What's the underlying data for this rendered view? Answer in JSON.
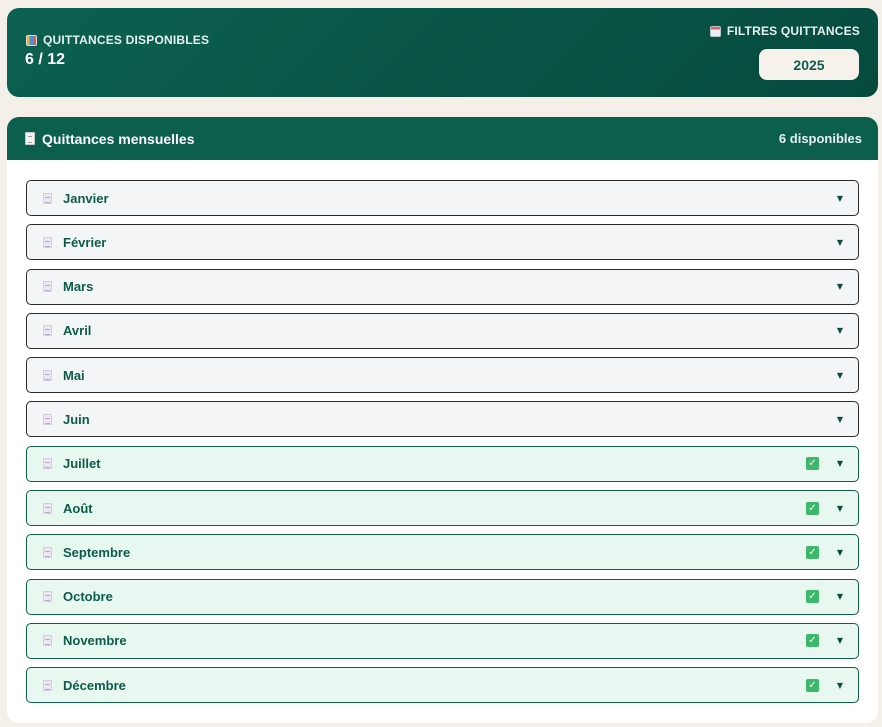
{
  "stats": {
    "label": "QUITTANCES DISPONIBLES",
    "value": "6 / 12",
    "icon": "bar-chart-icon"
  },
  "filters": {
    "label": "FILTRES QUITTANCES",
    "icon": "calendar-icon",
    "year": "2025"
  },
  "main": {
    "title": "Quittances mensuelles",
    "icon": "receipt-icon",
    "available_label": "6 disponibles"
  },
  "colors": {
    "primary": "#0c5e4d",
    "background": "#f5efe9",
    "available_bg": "#e8f7f0",
    "check": "#3cb86a"
  },
  "months": [
    {
      "name": "Janvier",
      "available": false
    },
    {
      "name": "Février",
      "available": false
    },
    {
      "name": "Mars",
      "available": false
    },
    {
      "name": "Avril",
      "available": false
    },
    {
      "name": "Mai",
      "available": false
    },
    {
      "name": "Juin",
      "available": false
    },
    {
      "name": "Juillet",
      "available": true
    },
    {
      "name": "Août",
      "available": true
    },
    {
      "name": "Septembre",
      "available": true
    },
    {
      "name": "Octobre",
      "available": true
    },
    {
      "name": "Novembre",
      "available": true
    },
    {
      "name": "Décembre",
      "available": true
    }
  ]
}
